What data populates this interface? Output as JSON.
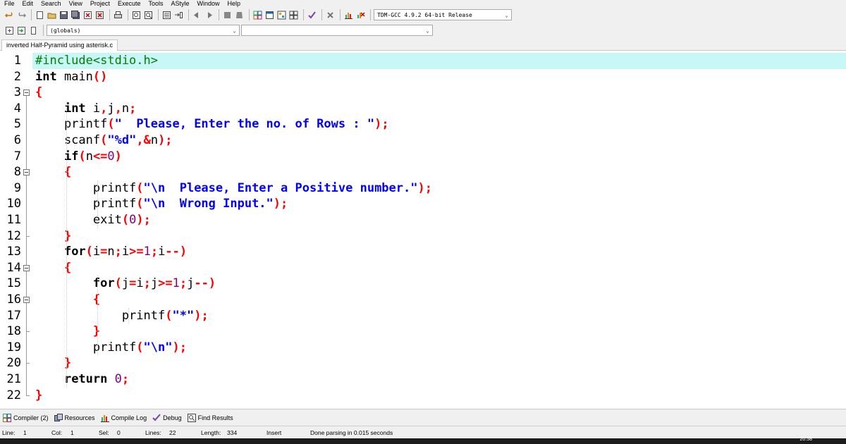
{
  "menu": [
    "File",
    "Edit",
    "Search",
    "View",
    "Project",
    "Execute",
    "Tools",
    "AStyle",
    "Window",
    "Help"
  ],
  "toolbar": {
    "compiler_select": "TDM-GCC 4.9.2 64-bit Release",
    "globals_select": "(globals)",
    "members_select": ""
  },
  "tab": {
    "filename": "inverted Half-Pyramid using asterisk.c"
  },
  "editor": {
    "line_numbers": [
      "1",
      "2",
      "3",
      "4",
      "5",
      "6",
      "7",
      "8",
      "9",
      "10",
      "11",
      "12",
      "13",
      "14",
      "15",
      "16",
      "17",
      "18",
      "19",
      "20",
      "21",
      "22"
    ],
    "highlight_color": "#c8f7f7",
    "lines": [
      [
        [
          "pp",
          "#include<stdio.h>"
        ]
      ],
      [
        [
          "kw",
          "int"
        ],
        [
          "id",
          " main"
        ],
        [
          "sym",
          "()"
        ]
      ],
      [
        [
          "sym",
          "{"
        ]
      ],
      [
        [
          "id",
          "    "
        ],
        [
          "kw",
          "int"
        ],
        [
          "id",
          " i"
        ],
        [
          "sym",
          ","
        ],
        [
          "id",
          "j"
        ],
        [
          "sym",
          ","
        ],
        [
          "id",
          "n"
        ],
        [
          "sym",
          ";"
        ]
      ],
      [
        [
          "id",
          "    printf"
        ],
        [
          "sym",
          "("
        ],
        [
          "str",
          "\"  Please, Enter the no. of Rows : \""
        ],
        [
          "sym",
          ");"
        ]
      ],
      [
        [
          "id",
          "    scanf"
        ],
        [
          "sym",
          "("
        ],
        [
          "str",
          "\"%d\""
        ],
        [
          "sym",
          ",&"
        ],
        [
          "id",
          "n"
        ],
        [
          "sym",
          ");"
        ]
      ],
      [
        [
          "id",
          "    "
        ],
        [
          "kw",
          "if"
        ],
        [
          "sym",
          "("
        ],
        [
          "id",
          "n"
        ],
        [
          "sym",
          "<="
        ],
        [
          "num",
          "0"
        ],
        [
          "sym",
          ")"
        ]
      ],
      [
        [
          "id",
          "    "
        ],
        [
          "sym",
          "{"
        ]
      ],
      [
        [
          "id",
          "        printf"
        ],
        [
          "sym",
          "("
        ],
        [
          "str",
          "\"\\n  Please, Enter a Positive number.\""
        ],
        [
          "sym",
          ");"
        ]
      ],
      [
        [
          "id",
          "        printf"
        ],
        [
          "sym",
          "("
        ],
        [
          "str",
          "\"\\n  Wrong Input.\""
        ],
        [
          "sym",
          ");"
        ]
      ],
      [
        [
          "id",
          "        exit"
        ],
        [
          "sym",
          "("
        ],
        [
          "num",
          "0"
        ],
        [
          "sym",
          ");"
        ]
      ],
      [
        [
          "id",
          "    "
        ],
        [
          "sym",
          "}"
        ]
      ],
      [
        [
          "id",
          "    "
        ],
        [
          "kw",
          "for"
        ],
        [
          "sym",
          "("
        ],
        [
          "id",
          "i"
        ],
        [
          "sym",
          "="
        ],
        [
          "id",
          "n"
        ],
        [
          "sym",
          ";"
        ],
        [
          "id",
          "i"
        ],
        [
          "sym",
          ">="
        ],
        [
          "num",
          "1"
        ],
        [
          "sym",
          ";"
        ],
        [
          "id",
          "i"
        ],
        [
          "sym",
          "--)"
        ]
      ],
      [
        [
          "id",
          "    "
        ],
        [
          "sym",
          "{"
        ]
      ],
      [
        [
          "id",
          "        "
        ],
        [
          "kw",
          "for"
        ],
        [
          "sym",
          "("
        ],
        [
          "id",
          "j"
        ],
        [
          "sym",
          "="
        ],
        [
          "id",
          "i"
        ],
        [
          "sym",
          ";"
        ],
        [
          "id",
          "j"
        ],
        [
          "sym",
          ">="
        ],
        [
          "num",
          "1"
        ],
        [
          "sym",
          ";"
        ],
        [
          "id",
          "j"
        ],
        [
          "sym",
          "--)"
        ]
      ],
      [
        [
          "id",
          "        "
        ],
        [
          "sym",
          "{"
        ]
      ],
      [
        [
          "id",
          "            printf"
        ],
        [
          "sym",
          "("
        ],
        [
          "str",
          "\"*\""
        ],
        [
          "sym",
          ");"
        ]
      ],
      [
        [
          "id",
          "        "
        ],
        [
          "sym",
          "}"
        ]
      ],
      [
        [
          "id",
          "        printf"
        ],
        [
          "sym",
          "("
        ],
        [
          "str",
          "\"\\n\""
        ],
        [
          "sym",
          ");"
        ]
      ],
      [
        [
          "id",
          "    "
        ],
        [
          "sym",
          "}"
        ]
      ],
      [
        [
          "id",
          "    "
        ],
        [
          "kw",
          "return"
        ],
        [
          "id",
          " "
        ],
        [
          "num",
          "0"
        ],
        [
          "sym",
          ";"
        ]
      ],
      [
        [
          "sym",
          "}"
        ]
      ]
    ]
  },
  "bottom_tabs": [
    {
      "icon": "compiler-icon",
      "label": "Compiler (2)"
    },
    {
      "icon": "resources-icon",
      "label": "Resources"
    },
    {
      "icon": "compile-log-icon",
      "label": "Compile Log"
    },
    {
      "icon": "debug-icon",
      "label": "Debug"
    },
    {
      "icon": "find-results-icon",
      "label": "Find Results"
    }
  ],
  "status": {
    "line_label": "Line:",
    "line_value": "1",
    "col_label": "Col:",
    "col_value": "1",
    "sel_label": "Sel:",
    "sel_value": "0",
    "lines_label": "Lines:",
    "lines_value": "22",
    "length_label": "Length:",
    "length_value": "334",
    "mode": "Insert",
    "message": "Done parsing in 0.015 seconds"
  },
  "taskbar": {
    "clock": "20:58"
  }
}
